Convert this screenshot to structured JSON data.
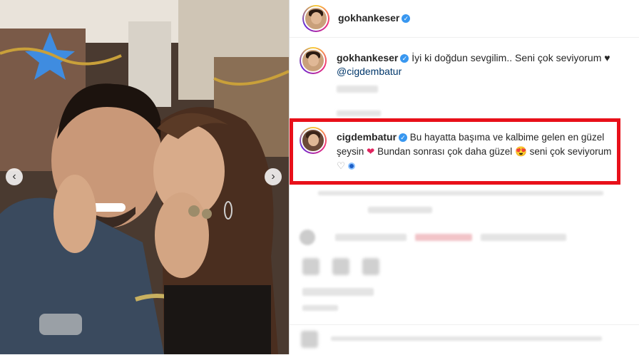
{
  "post_author": {
    "username": "gokhankeser",
    "verified": true
  },
  "caption": {
    "username": "gokhankeser",
    "text": "İyi ki doğdun sevgilim.. Seni çok seviyorum ♥",
    "mention": "@cigdembatur"
  },
  "highlighted_comment": {
    "username": "cigdembatur",
    "text_part1": "Bu hayatta başıma ve kalbime gelen en güzel şeysin",
    "heart_emoji": "❤",
    "text_part2": "Bundan sonrası çok daha güzel",
    "smile_emoji": "😍",
    "text_part3": "seni çok seviyorum",
    "outline_heart": "♡"
  },
  "nav": {
    "prev": "‹",
    "next": "›"
  },
  "colors": {
    "highlight_border": "#e8101a",
    "verified": "#3897f0",
    "mention": "#00376b"
  },
  "icons": [
    "verified-badge-icon",
    "chevron-left-icon",
    "chevron-right-icon",
    "heart-icon",
    "comment-icon",
    "share-icon",
    "emoji-icon"
  ]
}
